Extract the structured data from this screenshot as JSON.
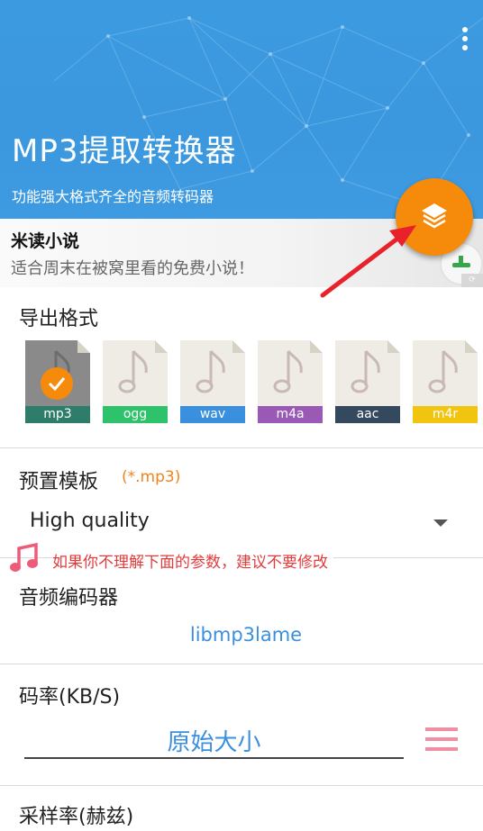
{
  "header": {
    "title": "MP3提取转换器",
    "subtitle": "功能强大格式齐全的音频转码器",
    "more_icon": "more-vert-icon",
    "background_color": "#3b98de"
  },
  "ad": {
    "title": "米读小说",
    "description": "适合周末在被窝里看的免费小说！"
  },
  "fab": {
    "icon": "layers-icon",
    "color": "#f58a0b"
  },
  "export": {
    "title": "导出格式",
    "selected": "mp3",
    "formats": [
      {
        "label": "mp3",
        "color": "#2e7d6a"
      },
      {
        "label": "ogg",
        "color": "#2ec26a"
      },
      {
        "label": "wav",
        "color": "#3a8fde"
      },
      {
        "label": "m4a",
        "color": "#9b59b6"
      },
      {
        "label": "aac",
        "color": "#34495e"
      },
      {
        "label": "m4r",
        "color": "#f1c40f"
      }
    ]
  },
  "template": {
    "title": "预置模板",
    "extension": "(*.mp3)",
    "selected": "High quality"
  },
  "warning": {
    "text": "如果你不理解下面的参数，建议不要修改",
    "icon": "music-note-icon"
  },
  "codec": {
    "title": "音频编码器",
    "value": "libmp3lame"
  },
  "bitrate": {
    "title": "码率(KB/S)",
    "value": "原始大小",
    "menu_icon": "menu-lines-icon"
  },
  "samplerate": {
    "title": "采样率(赫兹)"
  },
  "colors": {
    "accent": "#f58a0b",
    "link": "#3a8fde",
    "warning": "#e23b3b"
  }
}
